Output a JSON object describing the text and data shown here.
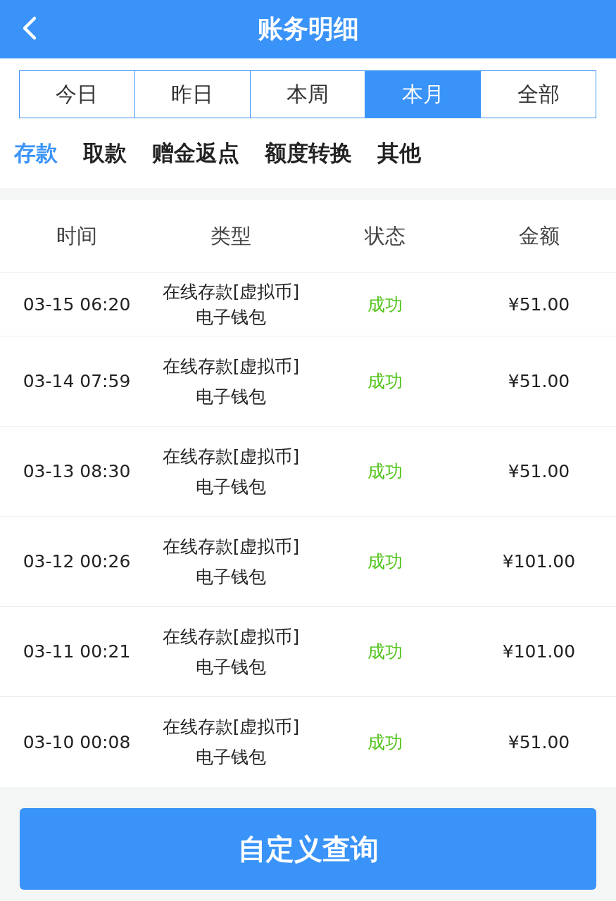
{
  "header": {
    "title": "账务明细"
  },
  "periods": [
    {
      "label": "今日",
      "selected": false
    },
    {
      "label": "昨日",
      "selected": false
    },
    {
      "label": "本周",
      "selected": false
    },
    {
      "label": "本月",
      "selected": true
    },
    {
      "label": "全部",
      "selected": false
    }
  ],
  "categories": [
    {
      "label": "存款",
      "selected": true
    },
    {
      "label": "取款",
      "selected": false
    },
    {
      "label": "赠金返点",
      "selected": false
    },
    {
      "label": "额度转换",
      "selected": false
    },
    {
      "label": "其他",
      "selected": false
    }
  ],
  "table": {
    "columns": [
      "时间",
      "类型",
      "状态",
      "金额"
    ],
    "rows": [
      {
        "time": "03-15 06:20",
        "type": "在线存款[虚拟币]",
        "channel": "电子钱包",
        "status": "成功",
        "amount": "¥51.00"
      },
      {
        "time": "03-14 07:59",
        "type": "在线存款[虚拟币]",
        "channel": "电子钱包",
        "status": "成功",
        "amount": "¥51.00"
      },
      {
        "time": "03-13 08:30",
        "type": "在线存款[虚拟币]",
        "channel": "电子钱包",
        "status": "成功",
        "amount": "¥51.00"
      },
      {
        "time": "03-12 00:26",
        "type": "在线存款[虚拟币]",
        "channel": "电子钱包",
        "status": "成功",
        "amount": "¥101.00"
      },
      {
        "time": "03-11 00:21",
        "type": "在线存款[虚拟币]",
        "channel": "电子钱包",
        "status": "成功",
        "amount": "¥101.00"
      },
      {
        "time": "03-10 00:08",
        "type": "在线存款[虚拟币]",
        "channel": "电子钱包",
        "status": "成功",
        "amount": "¥51.00"
      }
    ]
  },
  "query_button": "自定义查询"
}
